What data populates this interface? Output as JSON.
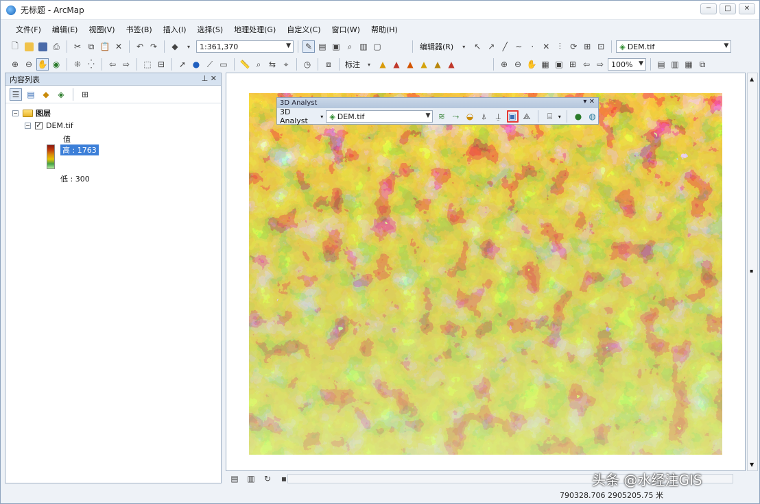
{
  "window": {
    "title": "无标题 - ArcMap",
    "controls": [
      "─",
      "□",
      "✕"
    ]
  },
  "menu": [
    "文件(F)",
    "编辑(E)",
    "视图(V)",
    "书签(B)",
    "插入(I)",
    "选择(S)",
    "地理处理(G)",
    "自定义(C)",
    "窗口(W)",
    "帮助(H)"
  ],
  "toolbar": {
    "scale": "1:361,370",
    "editor_label": "编辑器(R)",
    "layer_combo": "DEM.tif",
    "georef_label": "标注",
    "zoom_combo": "100%"
  },
  "toc": {
    "header": "内容列表",
    "layers_root": "图层",
    "layer_name": "DEM.tif",
    "value_label": "值",
    "high_label": "高 : 1763",
    "low_label": "低 : 300"
  },
  "analyst": {
    "title": "3D Analyst",
    "menu_label": "3D Analyst",
    "layer": "DEM.tif"
  },
  "status": {
    "coordinates": "790328.706  2905205.75 米"
  },
  "watermark": "头条 @水经注GIS"
}
